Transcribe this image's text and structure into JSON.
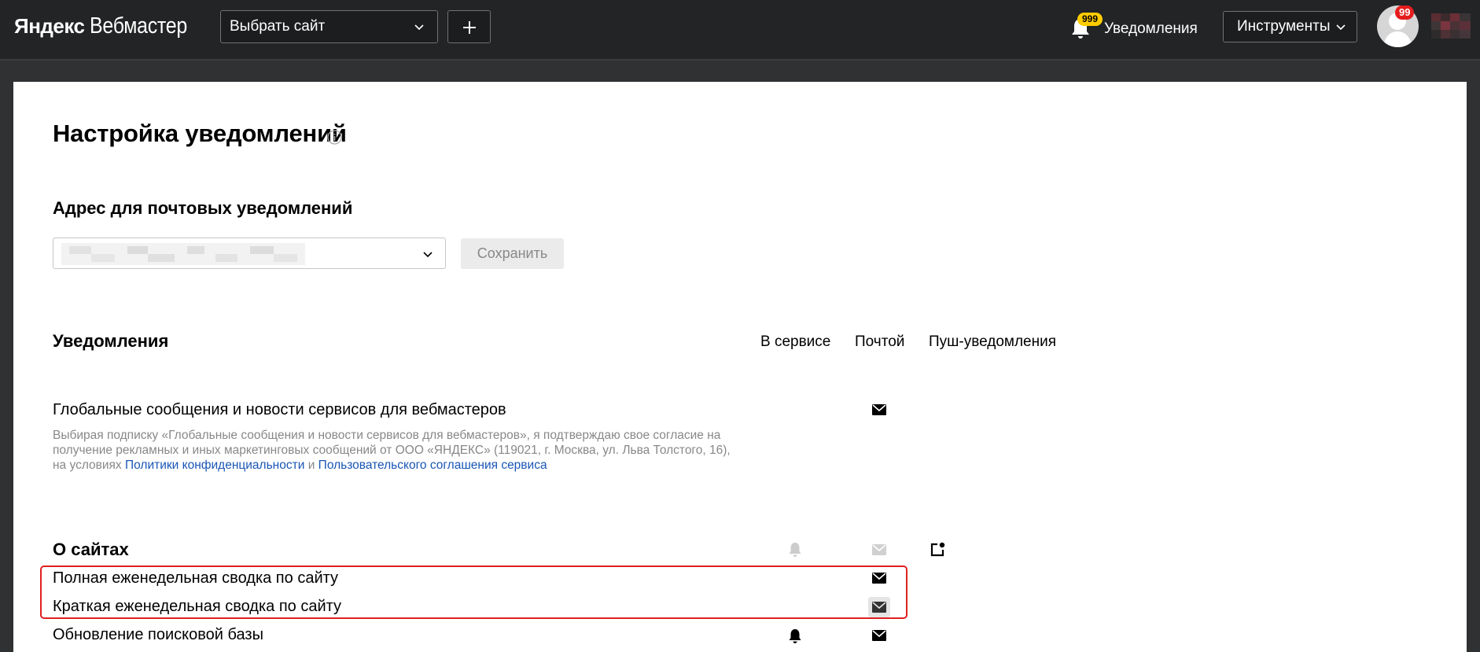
{
  "header": {
    "logo_brand": "Яндекс",
    "logo_product": "Вебмастер",
    "site_select_label": "Выбрать сайт",
    "add_site_icon": "plus-icon",
    "notifications_badge": "999",
    "notifications_label": "Уведомления",
    "tools_label": "Инструменты",
    "avatar_badge": "99"
  },
  "page": {
    "title": "Настройка уведомлений",
    "email_section_title": "Адрес для почтовых уведомлений",
    "save_label": "Сохранить",
    "notifications_section_title": "Уведомления",
    "columns": {
      "service": "В сервисе",
      "email": "Почтой",
      "push": "Пуш-уведомления"
    },
    "global_news": {
      "label": "Глобальные сообщения и новости сервисов для вебмастеров",
      "disclaimer_text": "Выбирая подписку «Глобальные сообщения и новости сервисов для вебмастеров», я подтверждаю свое согласие на получение рекламных и иных маркетинговых сообщений от ООО «ЯНДЕКС» (119021, г. Москва, ул. Льва Толстого, 16), на условиях",
      "privacy_link": "Политики конфиденциальности",
      "and_text": "и",
      "agreement_link": "Пользовательского соглашения сервиса"
    },
    "sites_group": {
      "title": "О сайтах",
      "rows": [
        {
          "label": "Полная еженедельная сводка по сайту"
        },
        {
          "label": "Краткая еженедельная сводка по сайту"
        },
        {
          "label": "Обновление поисковой базы"
        }
      ]
    }
  },
  "colors": {
    "header_bg": "#222426",
    "page_bg": "#2f3133",
    "badge_yellow": "#ffcc00",
    "badge_red": "#e51c1c",
    "link": "#1a56b5",
    "highlight": "#e02020"
  }
}
